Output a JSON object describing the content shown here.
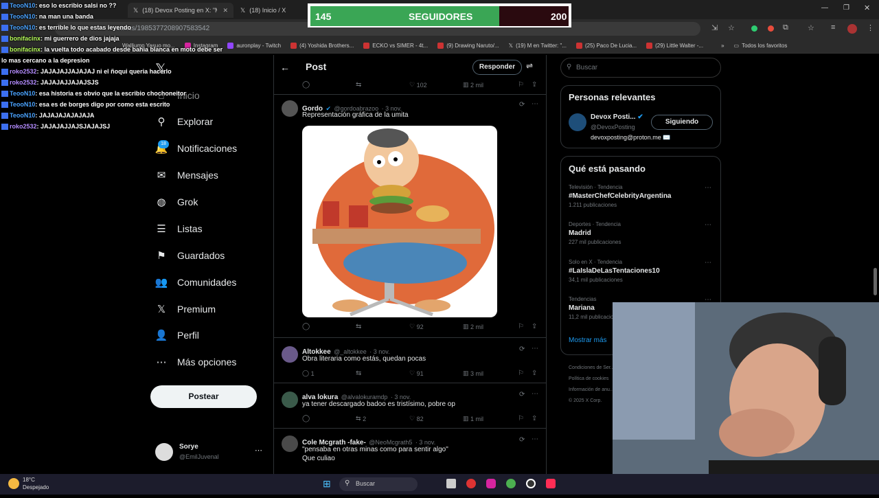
{
  "browser": {
    "tabs": [
      {
        "label": "(18) Devox Posting en X: \"Me c...",
        "active": true
      },
      {
        "label": "(18) Inicio / X",
        "active": false
      }
    ],
    "url": "status/1985377208907583542",
    "bookmarks": [
      "Walljump Yasuo mo...",
      "Instagram",
      "auronplay - Twitch",
      "(4) Yoshida Brothers...",
      "ECKO vs SIMER - 4t...",
      "(9) Drawing Naruto/...",
      "(19) M en Twitter: \"...",
      "(25) Paco De Lucia...",
      "(29) Little Walter -...",
      "Todos los favoritos"
    ]
  },
  "overlay": {
    "followers_left": "145",
    "followers_label": "SEGUIDORES",
    "followers_right": "200",
    "chat": [
      {
        "user": "TeooN10",
        "msg": ": eso lo escribio salsi no ??",
        "c": "u1"
      },
      {
        "user": "TeooN10",
        "msg": ": na man una banda",
        "c": "u1"
      },
      {
        "user": "TeooN10",
        "msg": ": es terrible lo que estas leyendo",
        "c": "u1"
      },
      {
        "user": "bonifacinx",
        "msg": ": mi guerrero de dios jajaja",
        "c": "u2"
      },
      {
        "user": "bonifacinx",
        "msg": ": la vuelta todo acabado desde bahia blanca en moto debe ser lo mas cercano a la depresion",
        "c": "u2"
      },
      {
        "user": "roko2532",
        "msg": ": JAJAJAJJAJAJAJ ni el ñoqui queria hacerlo",
        "c": "u3"
      },
      {
        "user": "roko2532",
        "msg": ": JAJAJAJJAJAJSJS",
        "c": "u3"
      },
      {
        "user": "TeooN10",
        "msg": ": esa historia es obvio que la escribio chochoneitor",
        "c": "u1"
      },
      {
        "user": "TeooN10",
        "msg": ": esa es de borges digo por como esta escrito",
        "c": "u1"
      },
      {
        "user": "TeooN10",
        "msg": ": JAJAJAJAJAJAJA",
        "c": "u1"
      },
      {
        "user": "roko2532",
        "msg": ": JAJAJAJJAJSJAJAJSJ",
        "c": "u3"
      }
    ]
  },
  "nav": {
    "items": [
      {
        "label": "Inicio",
        "icon": "⌂"
      },
      {
        "label": "Explorar",
        "icon": "⚲"
      },
      {
        "label": "Notificaciones",
        "icon": "🔔"
      },
      {
        "label": "Mensajes",
        "icon": "✉"
      },
      {
        "label": "Grok",
        "icon": "◍"
      },
      {
        "label": "Listas",
        "icon": "☰"
      },
      {
        "label": "Guardados",
        "icon": "⚑"
      },
      {
        "label": "Comunidades",
        "icon": "👥"
      },
      {
        "label": "Premium",
        "icon": "𝕏"
      },
      {
        "label": "Perfil",
        "icon": "👤"
      },
      {
        "label": "Más opciones",
        "icon": "⋯"
      }
    ],
    "badge": "18",
    "post_button": "Postear",
    "profile_name": "Sorye",
    "profile_handle": "@EmilJuvenal"
  },
  "post": {
    "title": "Post",
    "reply_button": "Responder",
    "top_actions": {
      "likes": "102",
      "views": "2 mil"
    },
    "replies": [
      {
        "name": "Gordo",
        "handle": "@gordoabrazoo",
        "date": "· 3 nov.",
        "text": "Representación gráfica de la umita",
        "replies": "",
        "retweets": "",
        "likes": "92",
        "views": "2 mil",
        "verified": true
      },
      {
        "name": "Altokkee",
        "handle": "@_altokkee",
        "date": "· 3 nov.",
        "text": "Obra literaria como estás, quedan pocas",
        "replies": "1",
        "retweets": "",
        "likes": "91",
        "views": "3 mil"
      },
      {
        "name": "alva lokura",
        "handle": "@alvalokuramdp",
        "date": "· 3 nov.",
        "text": "ya tener descargado badoo es tristísimo, pobre op",
        "replies": "",
        "retweets": "2",
        "likes": "82",
        "views": "1 mil"
      },
      {
        "name": "Cole Mcgrath -fake-",
        "handle": "@NeoMcgrath5",
        "date": "· 3 nov.",
        "text": "\"pensaba en otras minas como para sentir algo\"",
        "text2": "Que culiao"
      }
    ]
  },
  "right": {
    "search_placeholder": "Buscar",
    "relevant_title": "Personas relevantes",
    "person_name": "Devox Posti...",
    "person_handle": "@DevoxPosting",
    "person_bio": "devoxposting@proton.me ✉️",
    "follow_button": "Siguiendo",
    "trends_title": "Qué está pasando",
    "trends": [
      {
        "meta": "Televisión · Tendencia",
        "title": "#MasterChefCelebrityArgentina",
        "count": "1.211 publicaciones"
      },
      {
        "meta": "Deportes · Tendencia",
        "title": "Madrid",
        "count": "227 mil publicaciones"
      },
      {
        "meta": "Solo en X · Tendencia",
        "title": "#LaIslaDeLasTentaciones10",
        "count": "34,1 mil publicaciones"
      },
      {
        "meta": "Tendencias",
        "title": "Mariana",
        "count": "11,2 mil publicaciones"
      }
    ],
    "show_more": "Mostrar más",
    "footer1": "Condiciones de Ser...",
    "footer2": "Política de cookies",
    "footer3": "Información de anu...",
    "footer4": "© 2025 X Corp."
  },
  "taskbar": {
    "temp": "18°C",
    "weather": "Despejado",
    "search": "Buscar"
  }
}
